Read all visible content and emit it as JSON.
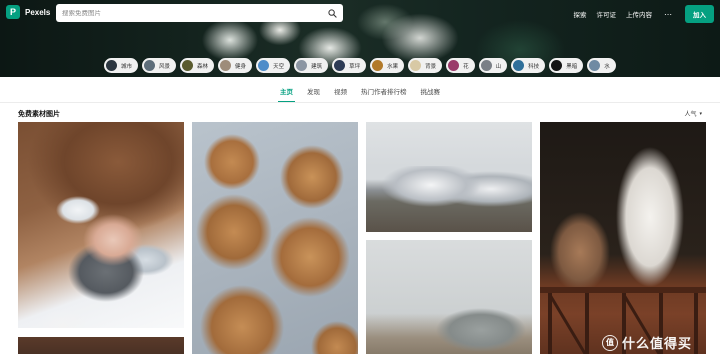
{
  "brand": {
    "name": "Pexels",
    "logo_letter": "P",
    "accent": "#05a081"
  },
  "search": {
    "placeholder": "搜索免费图片",
    "value": ""
  },
  "nav": {
    "links": [
      "探索",
      "许可证",
      "上传内容"
    ],
    "more": "⋯",
    "join_label": "加入"
  },
  "categories": [
    {
      "label": "城市",
      "color": "#2b3640"
    },
    {
      "label": "风景",
      "color": "#5d6d7a"
    },
    {
      "label": "森林",
      "color": "#5a5b2e"
    },
    {
      "label": "健身",
      "color": "#9e8c7a"
    },
    {
      "label": "天空",
      "color": "#4e8cc9"
    },
    {
      "label": "建筑",
      "color": "#8c96a3"
    },
    {
      "label": "草坪",
      "color": "#2d3b55"
    },
    {
      "label": "水果",
      "color": "#b27a2a"
    },
    {
      "label": "背景",
      "color": "#d8c9a5"
    },
    {
      "label": "花",
      "color": "#9a3a6a"
    },
    {
      "label": "山",
      "color": "#7a7f86"
    },
    {
      "label": "科技",
      "color": "#2f6f9a"
    },
    {
      "label": "黑暗",
      "color": "#141414"
    },
    {
      "label": "水",
      "color": "#6f8aa3"
    }
  ],
  "tabs": [
    {
      "label": "主页",
      "active": true
    },
    {
      "label": "发现",
      "active": false
    },
    {
      "label": "视频",
      "active": false
    },
    {
      "label": "热门作者排行榜",
      "active": false
    },
    {
      "label": "挑战赛",
      "active": false
    }
  ],
  "feed": {
    "title": "免费素材图片",
    "sort_label": "人气",
    "sort_caret": "▾"
  },
  "photos": [
    {
      "subject": "winter-portrait"
    },
    {
      "subject": "peanut-cookies"
    },
    {
      "subject": "snowy-mountains"
    },
    {
      "subject": "misty-hills"
    },
    {
      "subject": "white-horse"
    }
  ],
  "watermark": {
    "mark": "值",
    "text": "什么值得买"
  }
}
